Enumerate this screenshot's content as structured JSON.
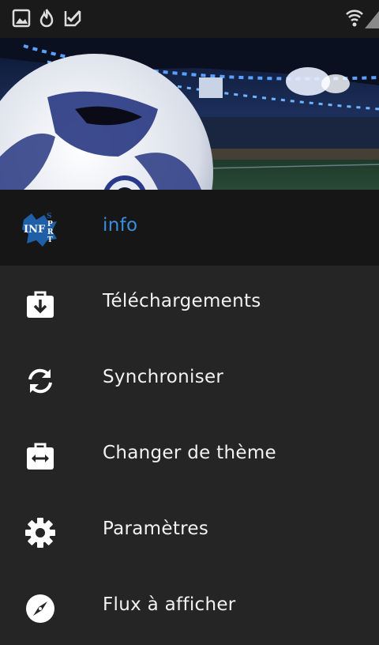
{
  "status_bar": {
    "left_icons": [
      "image-icon",
      "flame-icon",
      "checkbox-icon"
    ],
    "right_icons": [
      "wifi-icon",
      "signal-icon"
    ]
  },
  "header": {
    "image": "soccer-ball-stadium-image"
  },
  "menu": {
    "items": [
      {
        "label": "info",
        "icon": "info-sport-logo",
        "active": true
      },
      {
        "label": "Téléchargements",
        "icon": "download-bag-icon",
        "active": false
      },
      {
        "label": "Synchroniser",
        "icon": "sync-icon",
        "active": false
      },
      {
        "label": "Changer de thème",
        "icon": "theme-switch-icon",
        "active": false
      },
      {
        "label": "Paramètres",
        "icon": "gear-icon",
        "active": false
      },
      {
        "label": "Flux à afficher",
        "icon": "compass-icon",
        "active": false
      }
    ]
  },
  "colors": {
    "background": "#252525",
    "active_bg": "#161616",
    "active_label": "#3b8de0",
    "statusbar_bg": "#1a1a1a"
  }
}
